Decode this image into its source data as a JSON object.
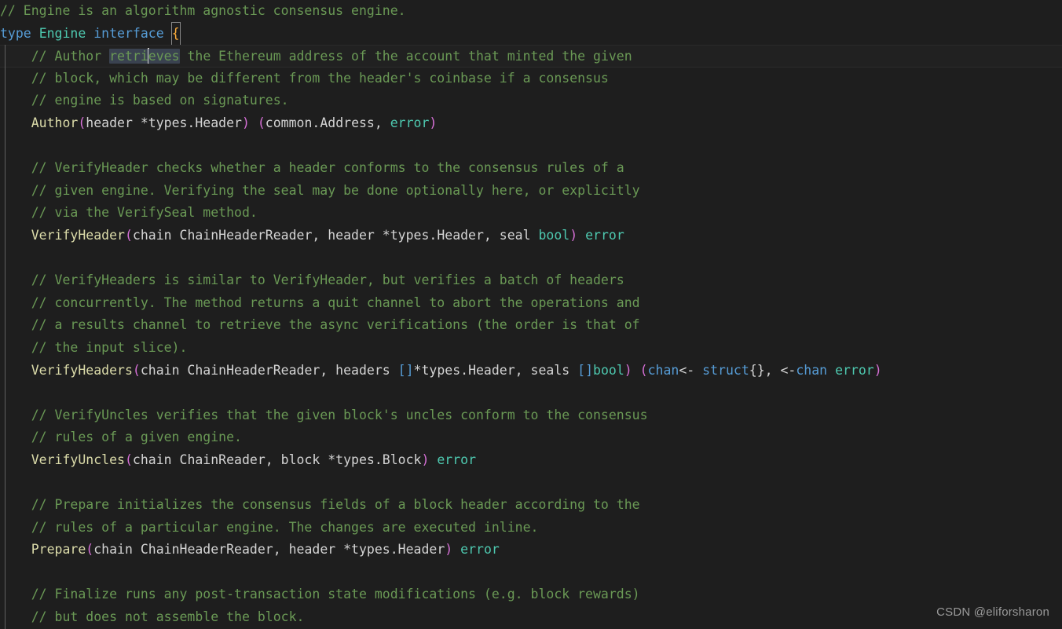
{
  "editor": {
    "language": "go",
    "theme": "dark-plus",
    "background": "#1e1e1e",
    "current_line_background": "#212121",
    "selection_background": "#3a4250",
    "colors": {
      "comment": "#6a9955",
      "keyword": "#569cd6",
      "type": "#4ec9b0",
      "function": "#dcdcaa",
      "paren": "#d670d6",
      "plain": "#d4d4d4",
      "bracket": "#569cd6",
      "brace_match": "#ffae3b",
      "indent_guide": "#606060"
    },
    "selected_text": "retrieves",
    "matched_bracket": "{"
  },
  "code": {
    "lines": [
      {
        "n": 1,
        "indent": 0,
        "tokens": [
          {
            "t": "cmt",
            "s": "// Engine is an algorithm agnostic consensus engine."
          }
        ]
      },
      {
        "n": 2,
        "indent": 0,
        "tokens": [
          {
            "t": "kw",
            "s": "type"
          },
          {
            "t": "plain",
            "s": " "
          },
          {
            "t": "typ",
            "s": "Engine"
          },
          {
            "t": "plain",
            "s": " "
          },
          {
            "t": "kw",
            "s": "interface"
          },
          {
            "t": "plain",
            "s": " "
          },
          {
            "t": "brace",
            "s": "{"
          }
        ]
      },
      {
        "n": 3,
        "indent": 1,
        "current": true,
        "tokens": [
          {
            "t": "cmt",
            "s": "// Author "
          },
          {
            "t": "sel-a",
            "s": "retri"
          },
          {
            "t": "caret",
            "s": ""
          },
          {
            "t": "sel-b",
            "s": "eves"
          },
          {
            "t": "cmt",
            "s": " the Ethereum address of the account that minted the given"
          }
        ]
      },
      {
        "n": 4,
        "indent": 1,
        "tokens": [
          {
            "t": "cmt",
            "s": "// block, which may be different from the header's coinbase if a consensus"
          }
        ]
      },
      {
        "n": 5,
        "indent": 1,
        "tokens": [
          {
            "t": "cmt",
            "s": "// engine is based on signatures."
          }
        ]
      },
      {
        "n": 6,
        "indent": 1,
        "tokens": [
          {
            "t": "fn",
            "s": "Author"
          },
          {
            "t": "paren",
            "s": "("
          },
          {
            "t": "plain",
            "s": "header *types.Header"
          },
          {
            "t": "paren",
            "s": ")"
          },
          {
            "t": "plain",
            "s": " "
          },
          {
            "t": "paren",
            "s": "("
          },
          {
            "t": "plain",
            "s": "common.Address, "
          },
          {
            "t": "typ",
            "s": "error"
          },
          {
            "t": "paren",
            "s": ")"
          }
        ]
      },
      {
        "n": 7,
        "indent": 1,
        "tokens": []
      },
      {
        "n": 8,
        "indent": 1,
        "tokens": [
          {
            "t": "cmt",
            "s": "// VerifyHeader checks whether a header conforms to the consensus rules of a"
          }
        ]
      },
      {
        "n": 9,
        "indent": 1,
        "tokens": [
          {
            "t": "cmt",
            "s": "// given engine. Verifying the seal may be done optionally here, or explicitly"
          }
        ]
      },
      {
        "n": 10,
        "indent": 1,
        "tokens": [
          {
            "t": "cmt",
            "s": "// via the VerifySeal method."
          }
        ]
      },
      {
        "n": 11,
        "indent": 1,
        "tokens": [
          {
            "t": "fn",
            "s": "VerifyHeader"
          },
          {
            "t": "paren",
            "s": "("
          },
          {
            "t": "plain",
            "s": "chain ChainHeaderReader, header *types.Header, seal "
          },
          {
            "t": "typ",
            "s": "bool"
          },
          {
            "t": "paren",
            "s": ")"
          },
          {
            "t": "plain",
            "s": " "
          },
          {
            "t": "typ",
            "s": "error"
          }
        ]
      },
      {
        "n": 12,
        "indent": 1,
        "tokens": []
      },
      {
        "n": 13,
        "indent": 1,
        "tokens": [
          {
            "t": "cmt",
            "s": "// VerifyHeaders is similar to VerifyHeader, but verifies a batch of headers"
          }
        ]
      },
      {
        "n": 14,
        "indent": 1,
        "tokens": [
          {
            "t": "cmt",
            "s": "// concurrently. The method returns a quit channel to abort the operations and"
          }
        ]
      },
      {
        "n": 15,
        "indent": 1,
        "tokens": [
          {
            "t": "cmt",
            "s": "// a results channel to retrieve the async verifications (the order is that of"
          }
        ]
      },
      {
        "n": 16,
        "indent": 1,
        "tokens": [
          {
            "t": "cmt",
            "s": "// the input slice)."
          }
        ]
      },
      {
        "n": 17,
        "indent": 1,
        "tokens": [
          {
            "t": "fn",
            "s": "VerifyHeaders"
          },
          {
            "t": "paren",
            "s": "("
          },
          {
            "t": "plain",
            "s": "chain ChainHeaderReader, headers "
          },
          {
            "t": "brk",
            "s": "[]"
          },
          {
            "t": "plain",
            "s": "*types.Header, seals "
          },
          {
            "t": "brk",
            "s": "[]"
          },
          {
            "t": "typ",
            "s": "bool"
          },
          {
            "t": "paren",
            "s": ")"
          },
          {
            "t": "plain",
            "s": " "
          },
          {
            "t": "paren",
            "s": "("
          },
          {
            "t": "kw",
            "s": "chan"
          },
          {
            "t": "plain",
            "s": "<- "
          },
          {
            "t": "kw",
            "s": "struct"
          },
          {
            "t": "plain",
            "s": "{}, <-"
          },
          {
            "t": "kw",
            "s": "chan"
          },
          {
            "t": "plain",
            "s": " "
          },
          {
            "t": "typ",
            "s": "error"
          },
          {
            "t": "paren",
            "s": ")"
          }
        ]
      },
      {
        "n": 18,
        "indent": 1,
        "tokens": []
      },
      {
        "n": 19,
        "indent": 1,
        "tokens": [
          {
            "t": "cmt",
            "s": "// VerifyUncles verifies that the given block's uncles conform to the consensus"
          }
        ]
      },
      {
        "n": 20,
        "indent": 1,
        "tokens": [
          {
            "t": "cmt",
            "s": "// rules of a given engine."
          }
        ]
      },
      {
        "n": 21,
        "indent": 1,
        "tokens": [
          {
            "t": "fn",
            "s": "VerifyUncles"
          },
          {
            "t": "paren",
            "s": "("
          },
          {
            "t": "plain",
            "s": "chain ChainReader, block *types.Block"
          },
          {
            "t": "paren",
            "s": ")"
          },
          {
            "t": "plain",
            "s": " "
          },
          {
            "t": "typ",
            "s": "error"
          }
        ]
      },
      {
        "n": 22,
        "indent": 1,
        "tokens": []
      },
      {
        "n": 23,
        "indent": 1,
        "tokens": [
          {
            "t": "cmt",
            "s": "// Prepare initializes the consensus fields of a block header according to the"
          }
        ]
      },
      {
        "n": 24,
        "indent": 1,
        "tokens": [
          {
            "t": "cmt",
            "s": "// rules of a particular engine. The changes are executed inline."
          }
        ]
      },
      {
        "n": 25,
        "indent": 1,
        "tokens": [
          {
            "t": "fn",
            "s": "Prepare"
          },
          {
            "t": "paren",
            "s": "("
          },
          {
            "t": "plain",
            "s": "chain ChainHeaderReader, header *types.Header"
          },
          {
            "t": "paren",
            "s": ")"
          },
          {
            "t": "plain",
            "s": " "
          },
          {
            "t": "typ",
            "s": "error"
          }
        ]
      },
      {
        "n": 26,
        "indent": 1,
        "tokens": []
      },
      {
        "n": 27,
        "indent": 1,
        "tokens": [
          {
            "t": "cmt",
            "s": "// Finalize runs any post-transaction state modifications (e.g. block rewards)"
          }
        ]
      },
      {
        "n": 28,
        "indent": 1,
        "tokens": [
          {
            "t": "cmt",
            "s": "// but does not assemble the block."
          }
        ]
      }
    ]
  },
  "watermark": {
    "text": "CSDN @eliforsharon"
  }
}
